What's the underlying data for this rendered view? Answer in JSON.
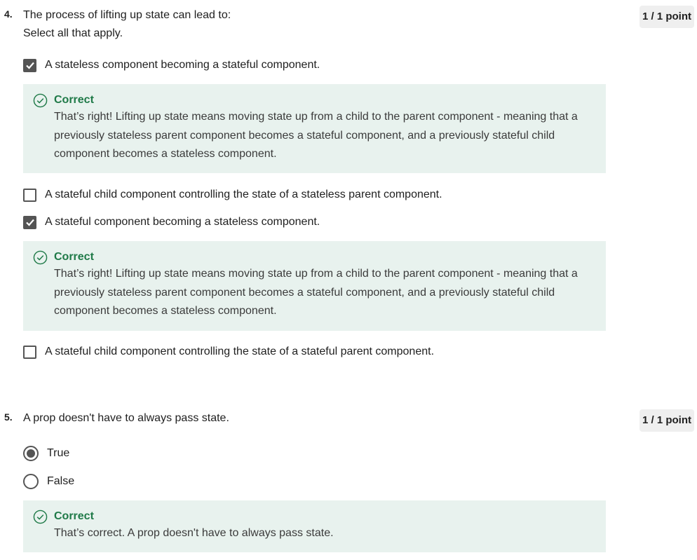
{
  "q4": {
    "number": "4.",
    "prompt_line1": "The process of lifting up state can lead to:",
    "prompt_line2": "Select all that apply.",
    "points": "1 / 1 point",
    "options": [
      {
        "label": "A stateless component becoming a stateful component.",
        "checked": true
      },
      {
        "label": "A stateful child component controlling the state of a stateless parent component.",
        "checked": false
      },
      {
        "label": "A stateful component becoming a stateless component.",
        "checked": true
      },
      {
        "label": "A stateful child component controlling the state of a stateful parent component.",
        "checked": false
      }
    ],
    "feedback": [
      {
        "title": "Correct",
        "line1": "That’s right! Lifting up state means moving state up from a child to the parent component - meaning that a",
        "line2": "previously stateless parent component becomes a stateful component, and a previously stateful child",
        "line3": "component becomes a stateless component."
      },
      {
        "title": "Correct",
        "line1": "That’s right! Lifting up state means moving state up from a child to the parent component - meaning that a",
        "line2": "previously stateless parent component becomes a stateful component, and a previously stateful child",
        "line3": "component becomes a stateless component."
      }
    ]
  },
  "q5": {
    "number": "5.",
    "prompt": "A prop doesn't have to always pass state.",
    "points": "1 / 1 point",
    "options": [
      {
        "label": "True",
        "selected": true
      },
      {
        "label": "False",
        "selected": false
      }
    ],
    "feedback": {
      "title": "Correct",
      "text": "That’s correct. A prop doesn't have to always pass state."
    }
  },
  "icons": {
    "check": "checkmark-icon",
    "correct": "check-circle-icon"
  },
  "colors": {
    "correct_green": "#1f7a48",
    "feedback_bg": "#e8f2ee",
    "control_dark": "#545454",
    "points_bg": "#efefef"
  }
}
